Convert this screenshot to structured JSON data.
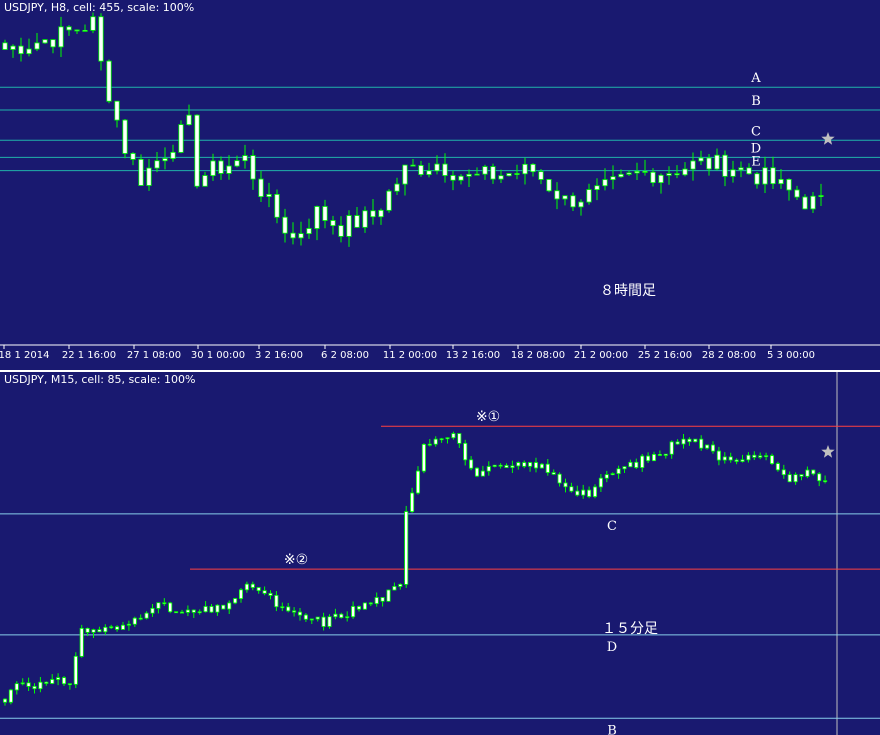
{
  "chart_data": [
    {
      "type": "candlestick",
      "title": "USDJPY, H8, cell: 455, scale: 100%",
      "x_ticks": [
        "18 1 2014",
        "22 1 16:00",
        "27 1 08:00",
        "30 1 00:00",
        "3 2 16:00",
        "6 2 08:00",
        "11 2 00:00",
        "13 2 16:00",
        "18 2 08:00",
        "21 2 00:00",
        "25 2 16:00",
        "28 2 08:00",
        "5 3 00:00"
      ],
      "levels": [
        {
          "name": "A",
          "value": 103.6
        },
        {
          "name": "B",
          "value": 103.0
        },
        {
          "name": "C",
          "value": 102.2
        },
        {
          "name": "D",
          "value": 101.75
        },
        {
          "name": "E",
          "value": 101.4
        }
      ],
      "annotation": "８時間足",
      "marker": "★",
      "ylim": [
        96.8,
        105.9
      ],
      "series": []
    },
    {
      "type": "candlestick",
      "title": "USDJPY, M15, cell: 85, scale: 100%",
      "levels": [
        {
          "name": "C",
          "value": 101.78
        },
        {
          "name": "D",
          "value": 101.2
        },
        {
          "name": "B",
          "value": 100.8
        }
      ],
      "resistance_lines": [
        {
          "label": "※①",
          "value": 102.2
        },
        {
          "label": "※②",
          "value": 101.515
        }
      ],
      "annotation": "１５分足",
      "marker": "★",
      "ylim": [
        100.72,
        102.46
      ],
      "series": []
    }
  ],
  "colors": {
    "background": "#191970",
    "up": "#ffffff",
    "down": "#ffffff",
    "wick": "#00ff00",
    "level": "#20b2aa",
    "level_light": "#87ceeb",
    "resistance": "#ff4040",
    "text": "#ffffff",
    "star": "#c0c0c0"
  }
}
